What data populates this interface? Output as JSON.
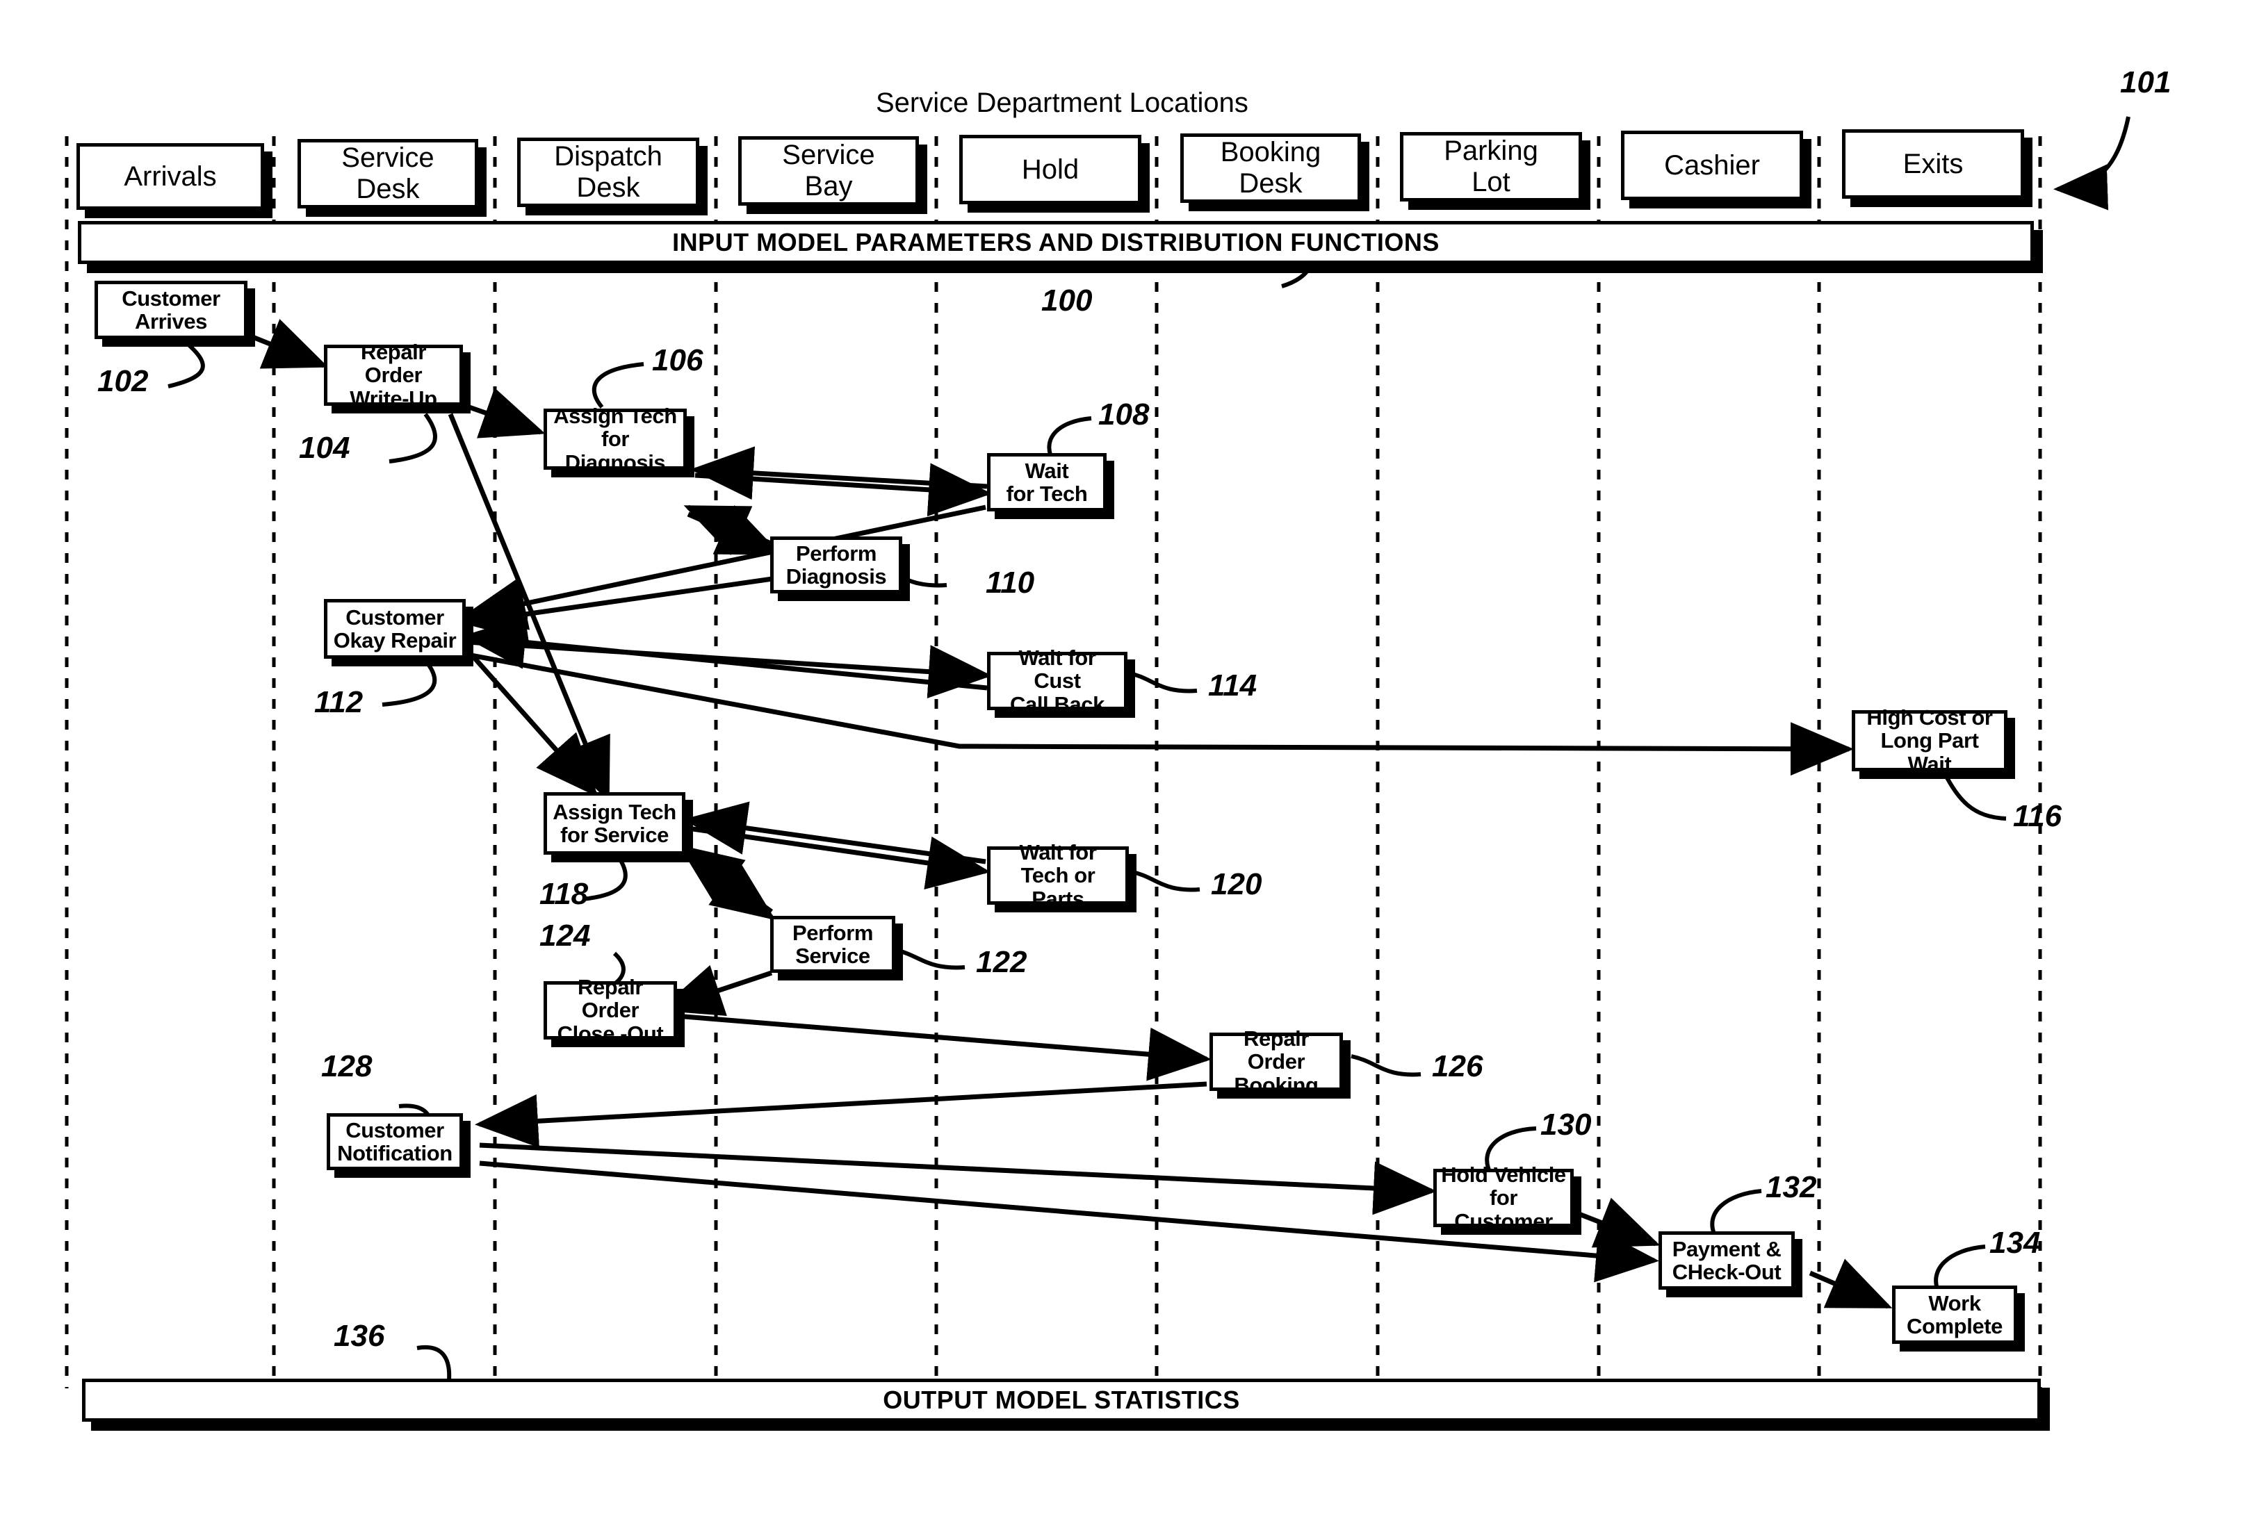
{
  "figure": {
    "title": "Service Department Locations",
    "figure_ref": "101"
  },
  "banners": {
    "input": {
      "label": "INPUT MODEL PARAMETERS AND DISTRIBUTION FUNCTIONS",
      "ref": "100"
    },
    "output": {
      "label": "OUTPUT MODEL STATISTICS",
      "ref": "136"
    }
  },
  "locations": [
    {
      "label": "Arrivals"
    },
    {
      "label": "Service\nDesk"
    },
    {
      "label": "Dispatch\nDesk"
    },
    {
      "label": "Service\nBay"
    },
    {
      "label": "Hold"
    },
    {
      "label": "Booking\nDesk"
    },
    {
      "label": "Parking\nLot"
    },
    {
      "label": "Cashier"
    },
    {
      "label": "Exits"
    }
  ],
  "nodes": [
    {
      "id": "n102",
      "label": "Customer\nArrives",
      "ref": "102",
      "location": "Arrivals"
    },
    {
      "id": "n104",
      "label": "Repair Order\nWrite-Up",
      "ref": "104",
      "location": "Service Desk"
    },
    {
      "id": "n106",
      "label": "Assign Tech\nfor Diagnosis",
      "ref": "106",
      "location": "Dispatch Desk"
    },
    {
      "id": "n108",
      "label": "Wait\nfor Tech",
      "ref": "108",
      "location": "Hold"
    },
    {
      "id": "n110",
      "label": "Perform\nDiagnosis",
      "ref": "110",
      "location": "Service Bay"
    },
    {
      "id": "n112",
      "label": "Customer\nOkay Repair",
      "ref": "112",
      "location": "Service Desk"
    },
    {
      "id": "n114",
      "label": "Wait for Cust\nCall Back",
      "ref": "114",
      "location": "Hold"
    },
    {
      "id": "n116",
      "label": "High Cost or\nLong Part Wait",
      "ref": "116",
      "location": "Exits"
    },
    {
      "id": "n118",
      "label": "Assign Tech\nfor Service",
      "ref": "118",
      "location": "Dispatch Desk"
    },
    {
      "id": "n120",
      "label": "Wait for\nTech or Parts",
      "ref": "120",
      "location": "Hold"
    },
    {
      "id": "n122",
      "label": "Perform\nService",
      "ref": "122",
      "location": "Service Bay"
    },
    {
      "id": "n124",
      "label": "Repair Order\nClose -Out",
      "ref": "124",
      "location": "Dispatch Desk"
    },
    {
      "id": "n126",
      "label": "Repair Order\nBooking",
      "ref": "126",
      "location": "Booking Desk"
    },
    {
      "id": "n128",
      "label": "Customer\nNotification",
      "ref": "128",
      "location": "Service Desk"
    },
    {
      "id": "n130",
      "label": "Hold Vehicle\nfor Customer",
      "ref": "130",
      "location": "Parking Lot"
    },
    {
      "id": "n132",
      "label": "Payment &\nCHeck-Out",
      "ref": "132",
      "location": "Cashier"
    },
    {
      "id": "n134",
      "label": "Work\nComplete",
      "ref": "134",
      "location": "Exits"
    }
  ],
  "colors": {
    "ink": "#000000",
    "paper": "#ffffff"
  }
}
